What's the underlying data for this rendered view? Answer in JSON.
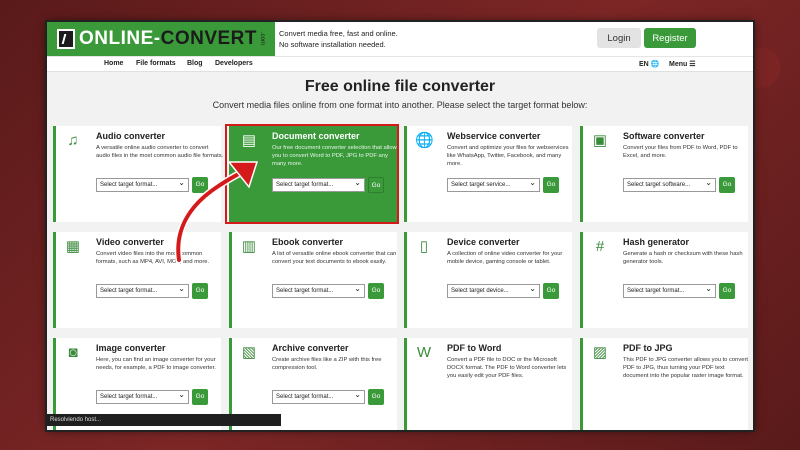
{
  "header": {
    "logo_text_a": "ONLINE-",
    "logo_text_b": "CONVERT",
    "logo_com": ".com",
    "tagline_1": "Convert media free, fast and online.",
    "tagline_2": "No software installation needed.",
    "login_label": "Login",
    "register_label": "Register"
  },
  "nav": {
    "items": [
      "Home",
      "File formats",
      "Blog",
      "Developers"
    ],
    "lang": "EN 🌐",
    "menu": "Menu ☰"
  },
  "hero": {
    "title": "Free online file converter",
    "subtitle": "Convert media files online from one format into another. Please select the target format below:"
  },
  "cards": [
    {
      "title": "Audio converter",
      "desc": "A versatile online audio converter to convert audio files in the most common audio file formats.",
      "select": "Select target format...",
      "go": "Go",
      "icon": "music-note-icon",
      "glyph": "♫"
    },
    {
      "title": "Document converter",
      "desc": "Our free document converter selection that allows you to convert Word to PDF, JPG to PDF any many more.",
      "select": "Select target format...",
      "go": "Go",
      "icon": "document-icon",
      "glyph": "▤"
    },
    {
      "title": "Webservice converter",
      "desc": "Convert and optimize your files for webservices like WhatsApp, Twitter, Facebook, and many more.",
      "select": "Select target service...",
      "go": "Go",
      "icon": "globe-icon",
      "glyph": "🌐"
    },
    {
      "title": "Software converter",
      "desc": "Convert your files from PDF to Word, PDF to Excel, and more.",
      "select": "Select target software...",
      "go": "Go",
      "icon": "monitor-icon",
      "glyph": "▣"
    },
    {
      "title": "Video converter",
      "desc": "Convert video files into the most common formats, such as MP4, AVI, MOV, and more.",
      "select": "Select target format...",
      "go": "Go",
      "icon": "film-icon",
      "glyph": "▦"
    },
    {
      "title": "Ebook converter",
      "desc": "A list of versatile online ebook converter that can convert your text documents to ebook easily.",
      "select": "Select target format...",
      "go": "Go",
      "icon": "books-icon",
      "glyph": "▥"
    },
    {
      "title": "Device converter",
      "desc": "A collection of online video converter for your mobile device, gaming console or tablet.",
      "select": "Select target device...",
      "go": "Go",
      "icon": "tablet-icon",
      "glyph": "▯"
    },
    {
      "title": "Hash generator",
      "desc": "Generate a hash or checksum with these hash generator tools.",
      "select": "Select target format...",
      "go": "Go",
      "icon": "hash-icon",
      "glyph": "#"
    },
    {
      "title": "Image converter",
      "desc": "Here, you can find an image converter for your needs, for example, a PDF to image converter.",
      "select": "Select target format...",
      "go": "Go",
      "icon": "camera-icon",
      "glyph": "◙"
    },
    {
      "title": "Archive converter",
      "desc": "Create archive files like a ZIP with this free compression tool.",
      "select": "Select target format...",
      "go": "Go",
      "icon": "archive-icon",
      "glyph": "▧"
    },
    {
      "title": "PDF to Word",
      "desc": "Convert a PDF file to DOC or the Microsoft DOCX format. The PDF to Word converter lets you easily edit your PDF files.",
      "select": "",
      "go": "",
      "icon": "word-file-icon",
      "glyph": "W"
    },
    {
      "title": "PDF to JPG",
      "desc": "This PDF to JPG converter allows you to convert PDF to JPG, thus turning your PDF text document into the popular raster image format.",
      "select": "",
      "go": "",
      "icon": "image-file-icon",
      "glyph": "▨"
    }
  ],
  "status_bar": "Resolviendo host...",
  "colors": {
    "brand": "#3a9a3a",
    "highlight_border": "#d41a1a",
    "arrow": "#d41a1a"
  }
}
